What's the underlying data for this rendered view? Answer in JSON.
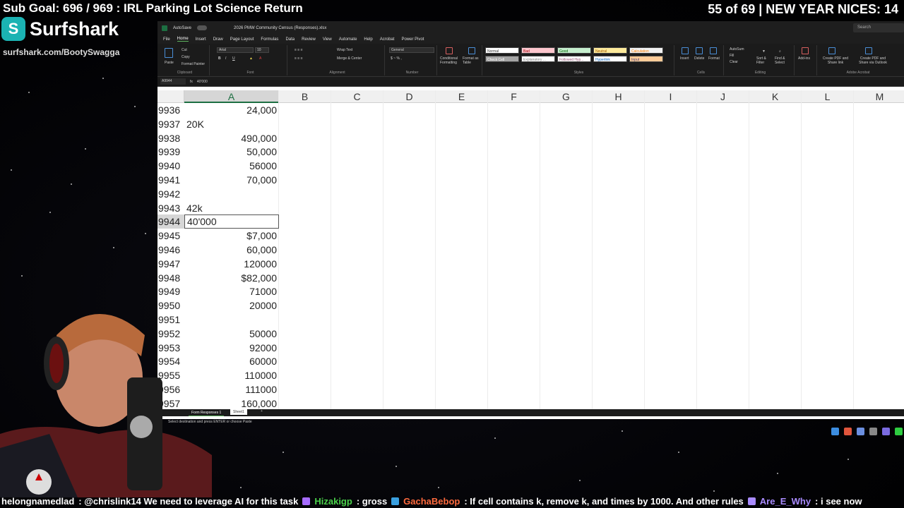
{
  "overlay": {
    "sub_goal": "Sub Goal: 696 / 969 : IRL Parking Lot Science Return",
    "nices": "55 of 69 | NEW YEAR NICES: 14",
    "sponsor_name": "Surfshark",
    "sponsor_url": "surfshark.com/BootySwagga"
  },
  "excel": {
    "autosave": "AutoSave",
    "toggle": "Off",
    "filename": "2026 PMW Community Census (Responses).xlsx",
    "search": "Search",
    "menu": [
      "File",
      "Home",
      "Insert",
      "Draw",
      "Page Layout",
      "Formulas",
      "Data",
      "Review",
      "View",
      "Automate",
      "Help",
      "Acrobat",
      "Power Pivot"
    ],
    "active_menu": "Home",
    "ribbon": {
      "clipboard": "Clipboard",
      "paste": "Paste",
      "cut": "Cut",
      "copy": "Copy",
      "format_painter": "Format Painter",
      "font": "Font",
      "font_name": "Arial",
      "font_size": "10",
      "alignment": "Alignment",
      "wrap_text": "Wrap Text",
      "merge_center": "Merge & Center",
      "number": "Number",
      "number_format": "General",
      "conditional": "Conditional Formatting",
      "format_table": "Format as Table",
      "styles": "Styles",
      "style_cells": [
        "Normal",
        "Bad",
        "Good",
        "Neutral",
        "Calculation",
        "Check Cell",
        "Explanatory ...",
        "Followed Hyp...",
        "Hyperlink",
        "Input"
      ],
      "cells": "Cells",
      "insert": "Insert",
      "delete": "Delete",
      "format": "Format",
      "autosum": "AutoSum",
      "fill": "Fill",
      "clear": "Clear",
      "sort_filter": "Sort & Filter",
      "find_select": "Find & Select",
      "editing": "Editing",
      "addins": "Add-ins",
      "create_pdf": "Create PDF and Share link",
      "create_pdf_outlook": "Create PDF and Share via Outlook",
      "adobe": "Adobe Acrobat"
    },
    "name_box": "A9944",
    "formula_value": "40'000",
    "columns": [
      "A",
      "B",
      "C",
      "D",
      "E",
      "F",
      "G",
      "H",
      "I",
      "J",
      "K",
      "L",
      "M"
    ],
    "rows": [
      {
        "num": "9936",
        "value": "24,000",
        "align": "num"
      },
      {
        "num": "9937",
        "value": "20K",
        "align": "txt"
      },
      {
        "num": "9938",
        "value": "490,000",
        "align": "num"
      },
      {
        "num": "9939",
        "value": "50,000",
        "align": "num"
      },
      {
        "num": "9940",
        "value": "56000",
        "align": "num"
      },
      {
        "num": "9941",
        "value": "70,000",
        "align": "num"
      },
      {
        "num": "9942",
        "value": "",
        "align": "num"
      },
      {
        "num": "9943",
        "value": "42k",
        "align": "txt"
      },
      {
        "num": "9944",
        "value": "40'000",
        "align": "txt",
        "active": true
      },
      {
        "num": "9945",
        "value": "$7,000",
        "align": "num"
      },
      {
        "num": "9946",
        "value": "60,000",
        "align": "num"
      },
      {
        "num": "9947",
        "value": "120000",
        "align": "num"
      },
      {
        "num": "9948",
        "value": "$82,000",
        "align": "num"
      },
      {
        "num": "9949",
        "value": "71000",
        "align": "num"
      },
      {
        "num": "9950",
        "value": "20000",
        "align": "num"
      },
      {
        "num": "9951",
        "value": "",
        "align": "num"
      },
      {
        "num": "9952",
        "value": "50000",
        "align": "num"
      },
      {
        "num": "9953",
        "value": "92000",
        "align": "num"
      },
      {
        "num": "9954",
        "value": "60000",
        "align": "num"
      },
      {
        "num": "9955",
        "value": "110000",
        "align": "num"
      },
      {
        "num": "9956",
        "value": "111000",
        "align": "num"
      },
      {
        "num": "9957",
        "value": "160,000",
        "align": "num"
      }
    ],
    "sheet_tab": "Form Responses 1",
    "sheet_tab2": "Sheet1",
    "add_sheet": "+",
    "status": "Select destination and press ENTER or choose Paste"
  },
  "chat": [
    {
      "user": "helongnamedlad",
      "msg": ": @chrislink14 We need to leverage AI for this task",
      "color": "white"
    },
    {
      "user": "Hizakigp",
      "msg": ": gross",
      "color": "green"
    },
    {
      "user": "GachaBebop",
      "msg": ": If cell contains k, remove k, and times by 1000. And other rules",
      "color": "orange"
    },
    {
      "user": "Are_E_Why",
      "msg": ": i see now",
      "color": "purple"
    }
  ],
  "colors": {
    "excel_green": "#1d6f42",
    "ribbon_dark": "#1b1b1b",
    "surfshark": "#1bb3b3"
  }
}
